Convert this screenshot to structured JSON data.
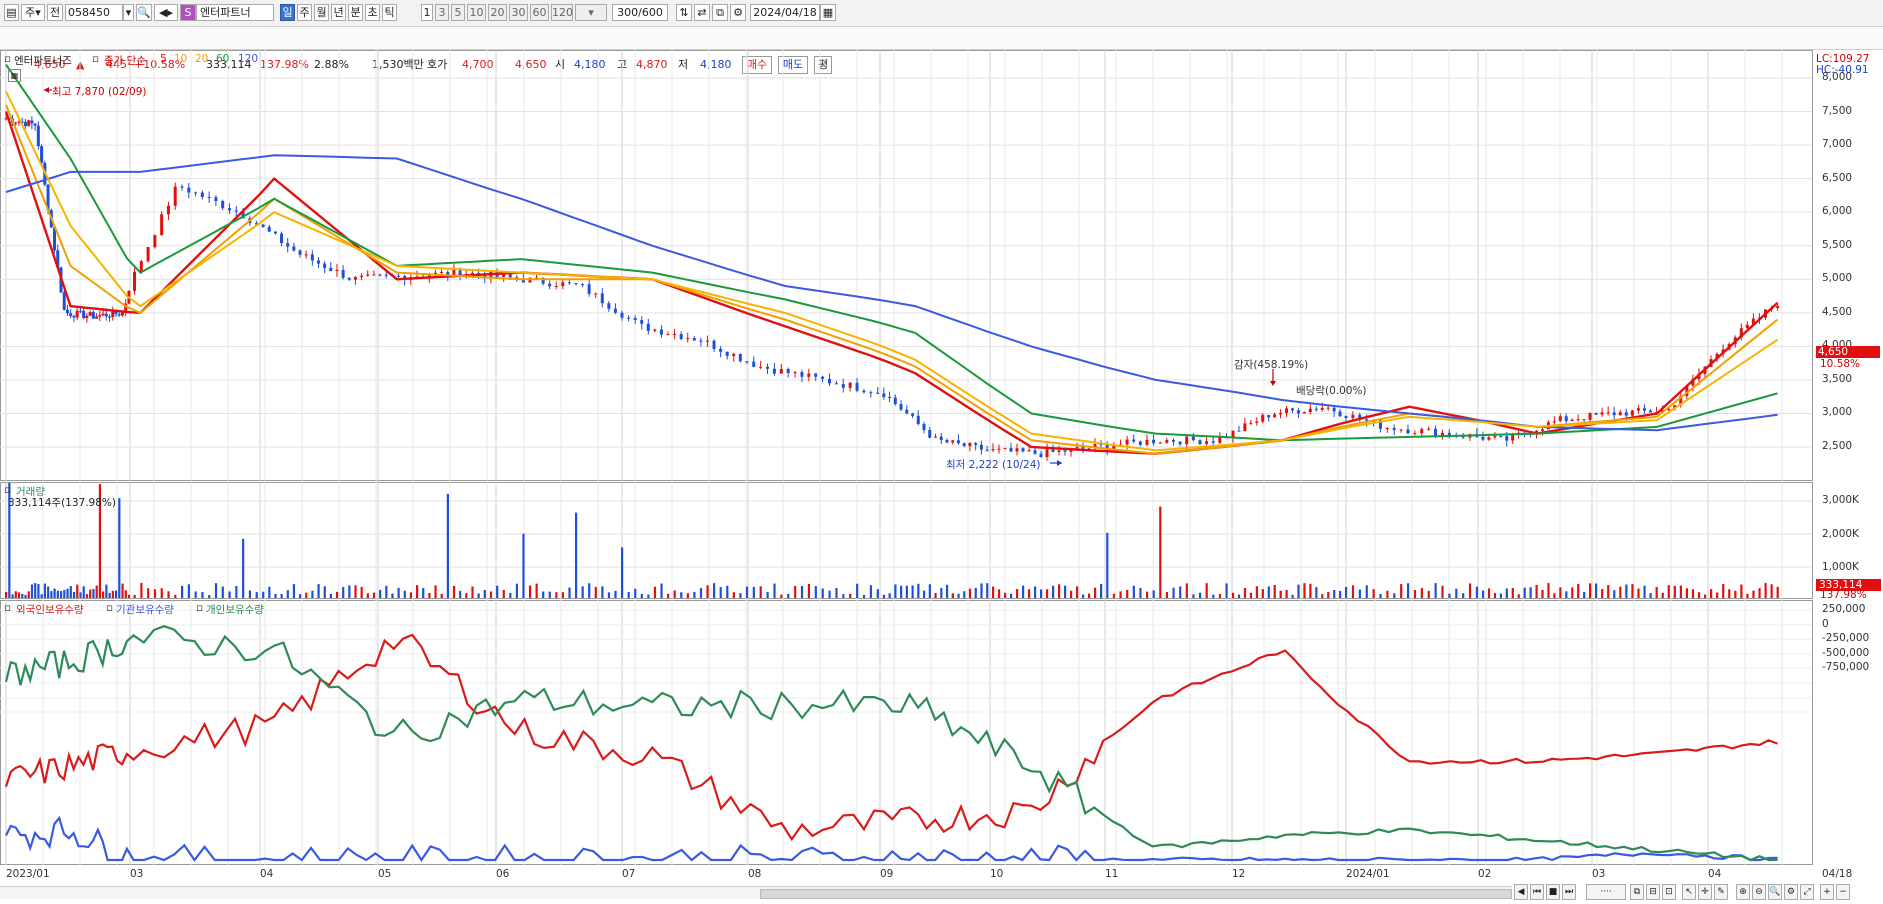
{
  "toolbar": {
    "market": "주",
    "code_mode": "전",
    "code": "058450",
    "stock_name": "엔터파트너",
    "periods": [
      "일",
      "주",
      "월",
      "년",
      "분",
      "초",
      "틱"
    ],
    "selected_period": "일",
    "intervals": [
      "1",
      "3",
      "5",
      "10",
      "20",
      "30",
      "60",
      "120"
    ],
    "count": "300",
    "count_max": "/600",
    "date": "2024/04/18"
  },
  "quote": {
    "price": "4,650",
    "change": "445",
    "change_pct": "+10.58%",
    "volume": "333,114",
    "volume_ratio": "137.98%",
    "turnover": "2.88%",
    "amount": "1,530백만",
    "hoga_label": "호가",
    "ask": "4,700",
    "bid": "4,650",
    "open_label": "시",
    "open": "4,180",
    "high_label": "고",
    "high": "4,870",
    "low_label": "저",
    "low": "4,180",
    "buy_label": "매수",
    "sell_label": "매도",
    "eval_label": "평"
  },
  "price_panel": {
    "title": "엔터파트너즈",
    "ma_label": "종가 단순",
    "ma_periods": [
      "5",
      "10",
      "20",
      "60",
      "120"
    ],
    "ma_colors": [
      "#e01010",
      "#f0a000",
      "#f0a000",
      "#1a9a3a",
      "#3a5ae0"
    ],
    "lc": "LC:109.27",
    "hc": "HC:-40.91",
    "y_ticks": [
      "8,000",
      "7,500",
      "7,000",
      "6,500",
      "6,000",
      "5,500",
      "5,000",
      "4,500",
      "4,000",
      "3,500",
      "3,000",
      "2,500"
    ],
    "last_price_tag": "4,650",
    "last_pct_tag": "10.58%",
    "high_annotation": "최고 7,870 (02/09)",
    "low_annotation": "최저 2,222 (10/24)",
    "event1": "감자(458.19%)",
    "event2": "배당락(0.00%)"
  },
  "volume_panel": {
    "title": "거래량",
    "value": "333,114주(137.98%)",
    "y_ticks": [
      "3,000K",
      "2,000K",
      "1,000K"
    ],
    "last_tag": "333,114",
    "last_pct_tag": "137.98%"
  },
  "holding_panel": {
    "series": [
      {
        "name": "외국인보유수량",
        "color": "#d81c1c"
      },
      {
        "name": "기관보유수량",
        "color": "#3a5ae0"
      },
      {
        "name": "개인보유수량",
        "color": "#2e8b57"
      }
    ],
    "y_ticks": [
      "250,000",
      "0",
      "-250,000",
      "-500,000",
      "-750,000"
    ]
  },
  "x_axis": {
    "labels": [
      "2023/01",
      "03",
      "04",
      "05",
      "06",
      "07",
      "08",
      "09",
      "10",
      "11",
      "12",
      "2024/01",
      "02",
      "03",
      "04",
      "04/18"
    ]
  },
  "chart_data": {
    "type": "line",
    "title": "엔터파트너즈",
    "x": [
      "2023/01",
      "02",
      "03",
      "04",
      "05",
      "06",
      "07",
      "08",
      "09",
      "10",
      "11",
      "12",
      "2024/01",
      "02",
      "03",
      "04"
    ],
    "series": [
      {
        "name": "5",
        "values": [
          7500,
          4600,
          4500,
          6500,
          5000,
          5100,
          5000,
          4300,
          3600,
          2500,
          2400,
          2600,
          3100,
          2700,
          3000,
          4650
        ]
      },
      {
        "name": "10",
        "values": [
          7600,
          5200,
          4500,
          6200,
          5100,
          5000,
          5000,
          4400,
          3700,
          2600,
          2400,
          2600,
          3000,
          2800,
          2950,
          4400
        ]
      },
      {
        "name": "60",
        "values": [
          8200,
          6800,
          5100,
          6200,
          5200,
          5300,
          5100,
          4700,
          4200,
          3000,
          2700,
          2600,
          2650,
          2700,
          2800,
          3300
        ]
      },
      {
        "name": "120",
        "values": [
          6300,
          6600,
          6600,
          6850,
          6800,
          6200,
          5500,
          4900,
          4600,
          4000,
          3500,
          3200,
          3000,
          2800,
          2750,
          2980
        ]
      }
    ],
    "ylim": [
      2200,
      8300
    ],
    "high": 7870,
    "low": 2222
  }
}
